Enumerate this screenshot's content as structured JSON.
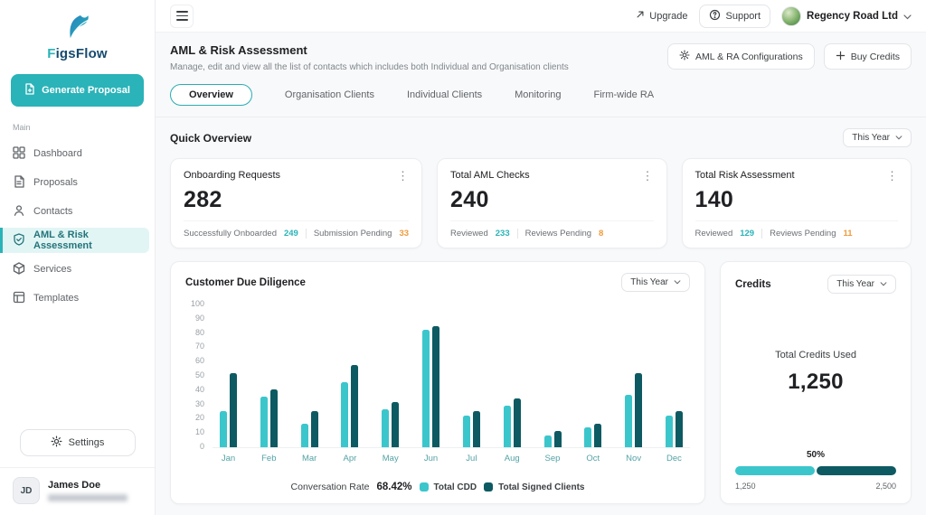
{
  "brand": {
    "name": "FigsFlow"
  },
  "icons": {
    "kebab": "⋮"
  },
  "topbar": {
    "upgrade_label": "Upgrade",
    "support_label": "Support",
    "account_name": "Regency Road Ltd"
  },
  "sidebar": {
    "generate_proposal_label": "Generate Proposal",
    "section_label": "Main",
    "items": [
      {
        "label": "Dashboard"
      },
      {
        "label": "Proposals"
      },
      {
        "label": "Contacts"
      },
      {
        "label": "AML & Risk Assessment"
      },
      {
        "label": "Services"
      },
      {
        "label": "Templates"
      }
    ],
    "settings_label": "Settings",
    "user": {
      "initials": "JD",
      "name": "James Doe"
    }
  },
  "header": {
    "title": "AML & Risk Assessment",
    "subtitle": "Manage, edit and view all the list of contacts which includes both Individual and Organisation clients",
    "config_button_label": "AML & RA Configurations",
    "buy_credits_label": "Buy Credits"
  },
  "tabs": [
    {
      "label": "Overview"
    },
    {
      "label": "Organisation Clients"
    },
    {
      "label": "Individual Clients"
    },
    {
      "label": "Monitoring"
    },
    {
      "label": "Firm-wide RA"
    }
  ],
  "quick_overview": {
    "title": "Quick Overview",
    "period": "This Year",
    "cards": [
      {
        "title": "Onboarding Requests",
        "value": "282",
        "stat1_label": "Successfully Onboarded",
        "stat1_value": "249",
        "stat2_label": "Submission Pending",
        "stat2_value": "33"
      },
      {
        "title": "Total AML Checks",
        "value": "240",
        "stat1_label": "Reviewed",
        "stat1_value": "233",
        "stat2_label": "Reviews Pending",
        "stat2_value": "8"
      },
      {
        "title": "Total Risk Assessment",
        "value": "140",
        "stat1_label": "Reviewed",
        "stat1_value": "129",
        "stat2_label": "Reviews Pending",
        "stat2_value": "11"
      }
    ]
  },
  "chart_card": {
    "title": "Customer Due Diligence",
    "period": "This Year",
    "conversation_rate_label": "Conversation Rate",
    "conversation_rate_value": "68.42%"
  },
  "chart_data": {
    "type": "bar",
    "title": "Customer Due Diligence",
    "categories": [
      "Jan",
      "Feb",
      "Mar",
      "Apr",
      "May",
      "Jun",
      "Jul",
      "Aug",
      "Sep",
      "Oct",
      "Nov",
      "Dec"
    ],
    "series": [
      {
        "name": "Total CDD",
        "color": "#3bc6cc",
        "values": [
          25,
          35,
          16,
          45,
          26,
          81,
          22,
          29,
          8,
          14,
          36,
          22
        ]
      },
      {
        "name": "Total Signed Clients",
        "color": "#0d5a62",
        "values": [
          51,
          40,
          25,
          57,
          31,
          84,
          25,
          34,
          11,
          16,
          51,
          25
        ]
      }
    ],
    "ylim": [
      0,
      100
    ],
    "yticks": [
      0,
      10,
      20,
      30,
      40,
      50,
      60,
      70,
      80,
      90,
      100
    ],
    "grid": false,
    "legend_position": "bottom"
  },
  "credits_card": {
    "title": "Credits",
    "period": "This Year",
    "total_label": "Total Credits Used",
    "total_value": "1,250",
    "percent_label": "50%",
    "progress_min_label": "1,250",
    "progress_max_label": "2,500",
    "bar_colors": [
      "#3bc6cc",
      "#0d5a62"
    ]
  },
  "colors": {
    "accent": "#2ab3b8",
    "positive": "#2ab3b8",
    "warning": "#ef9b3c"
  }
}
